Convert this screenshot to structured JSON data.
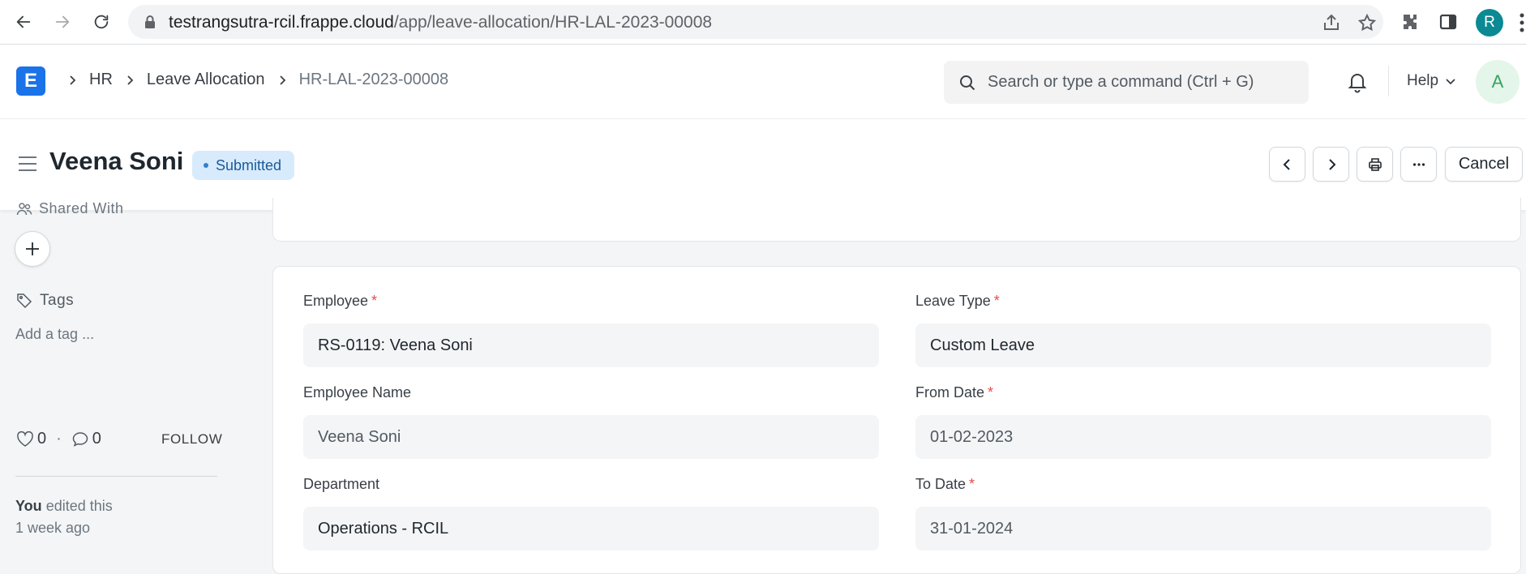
{
  "browser": {
    "url_host": "testrangsutra-rcil.frappe.cloud",
    "url_path": "/app/leave-allocation/HR-LAL-2023-00008",
    "profile_initial": "R"
  },
  "navbar": {
    "logo_letter": "E",
    "breadcrumbs": [
      "HR",
      "Leave Allocation",
      "HR-LAL-2023-00008"
    ],
    "search_placeholder": "Search or type a command (Ctrl + G)",
    "help_label": "Help",
    "avatar_initial": "A"
  },
  "page": {
    "title": "Veena Soni",
    "status": "Submitted",
    "cancel_label": "Cancel"
  },
  "sidebar": {
    "shared_with_label": "Shared With",
    "tags_label": "Tags",
    "add_tag_label": "Add a tag ...",
    "likes": "0",
    "comments": "0",
    "follow_label": "FOLLOW",
    "activity_user": "You",
    "activity_text": "edited this",
    "activity_time": "1 week ago"
  },
  "form": {
    "employee": {
      "label": "Employee",
      "value": "RS-0119: Veena Soni"
    },
    "leave_type": {
      "label": "Leave Type",
      "value": "Custom Leave"
    },
    "employee_name": {
      "label": "Employee Name",
      "value": "Veena Soni"
    },
    "from_date": {
      "label": "From Date",
      "value": "01-02-2023"
    },
    "department": {
      "label": "Department",
      "value": "Operations - RCIL"
    },
    "to_date": {
      "label": "To Date",
      "value": "31-01-2024"
    }
  },
  "colors": {
    "accent": "#1a73e8",
    "badge_bg": "#d8ebfd",
    "badge_text": "#1a5a99",
    "required": "#e24c4c"
  }
}
